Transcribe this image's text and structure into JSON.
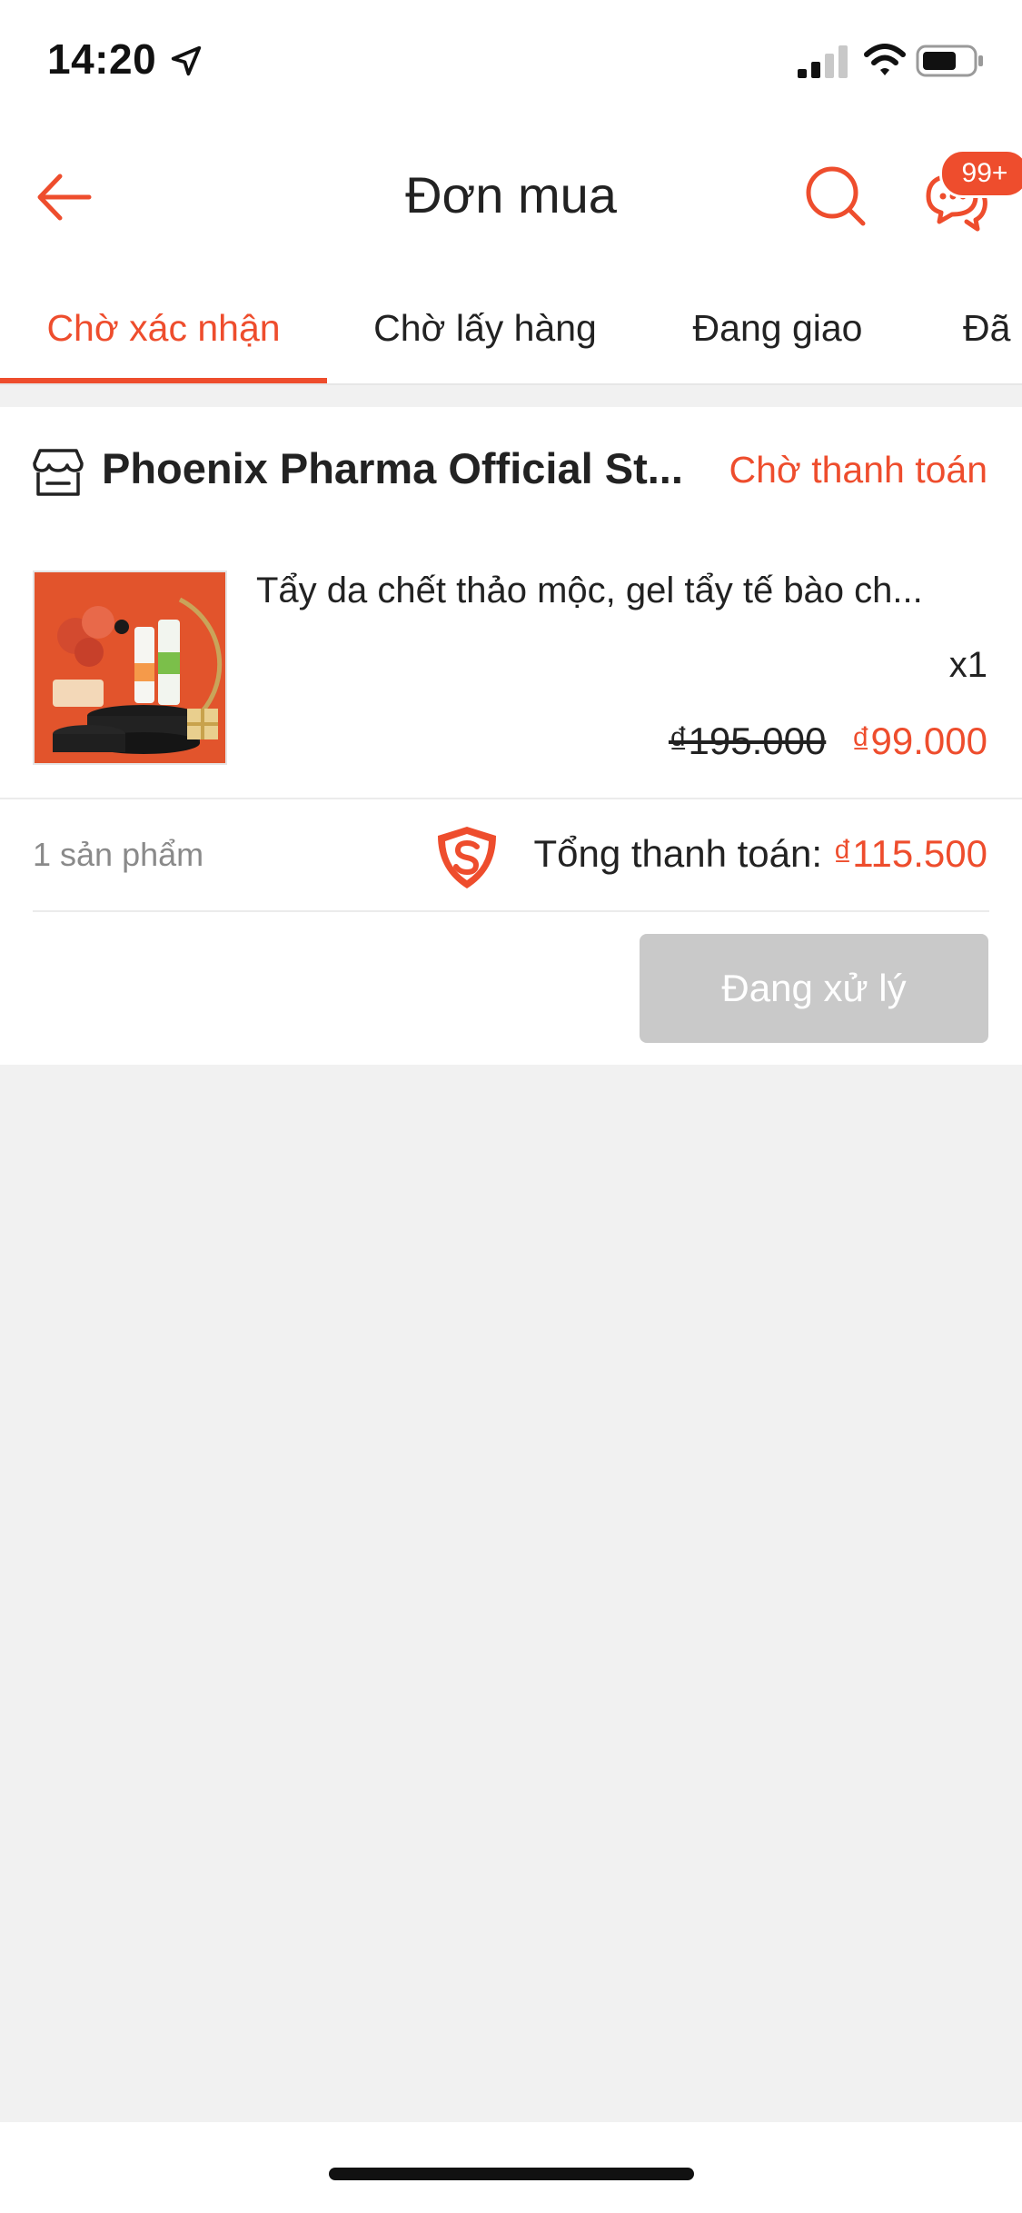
{
  "status_bar": {
    "time": "14:20",
    "icons": [
      "location-arrow-icon",
      "signal-icon",
      "wifi-icon",
      "battery-icon"
    ]
  },
  "header": {
    "title": "Đơn mua",
    "chat_badge": "99+",
    "icons": [
      "back-arrow-icon",
      "search-icon",
      "chat-icon"
    ]
  },
  "tabs": [
    {
      "label": "Chờ xác nhận",
      "active": true
    },
    {
      "label": "Chờ lấy hàng",
      "active": false
    },
    {
      "label": "Đang giao",
      "active": false
    },
    {
      "label": "Đã",
      "active": false
    }
  ],
  "order": {
    "shop_name": "Phoenix Pharma Official St...",
    "status": "Chờ thanh toán",
    "product": {
      "name": "Tẩy da chết thảo mộc, gel tẩy tế bào ch...",
      "quantity": "x1",
      "original_price": "₫195.000",
      "sale_price": "₫99.000"
    },
    "item_count": "1 sản phẩm",
    "total_label": "Tổng thanh toán:",
    "total_value": "₫115.500",
    "action_label": "Đang xử lý"
  },
  "colors": {
    "accent": "#ee4d2d",
    "disabled_button": "#c9c9c9",
    "background": "#f1f1f1"
  }
}
